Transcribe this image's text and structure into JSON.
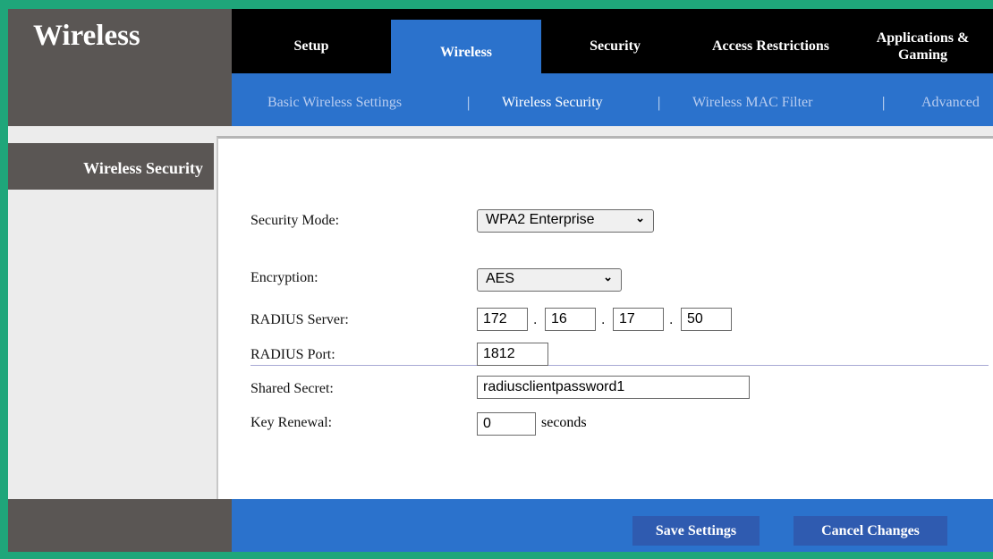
{
  "app": {
    "title": "Wireless"
  },
  "tabs": [
    {
      "label": "Setup"
    },
    {
      "label": "Wireless"
    },
    {
      "label": "Security"
    },
    {
      "label": "Access Restrictions"
    },
    {
      "label": "Applications & Gaming"
    }
  ],
  "subnav": {
    "items": [
      {
        "label": "Basic Wireless Settings"
      },
      {
        "label": "Wireless Security"
      },
      {
        "label": "Wireless MAC Filter"
      },
      {
        "label": "Advanced"
      }
    ],
    "separator": "|"
  },
  "sidebar": {
    "label": "Wireless Security"
  },
  "form": {
    "security_mode": {
      "label": "Security Mode:",
      "value": "WPA2 Enterprise"
    },
    "encryption": {
      "label": "Encryption:",
      "value": "AES"
    },
    "radius_server": {
      "label": "RADIUS Server:",
      "octets": [
        "172",
        "16",
        "17",
        "50"
      ],
      "dot": "."
    },
    "radius_port": {
      "label": "RADIUS Port:",
      "value": "1812"
    },
    "shared_secret": {
      "label": "Shared Secret:",
      "value": "radiusclientpassword1"
    },
    "key_renewal": {
      "label": "Key Renewal:",
      "value": "0",
      "unit": "seconds"
    }
  },
  "footer": {
    "save_label": "Save Settings",
    "cancel_label": "Cancel Changes"
  },
  "icons": {
    "dropdown": "chevron-down-icon"
  },
  "colors": {
    "accent": "#2b72cc",
    "header_dark": "#5a5654",
    "tabbar": "#000000",
    "button": "#2f5bb0",
    "border_frame": "#1fa67a"
  }
}
